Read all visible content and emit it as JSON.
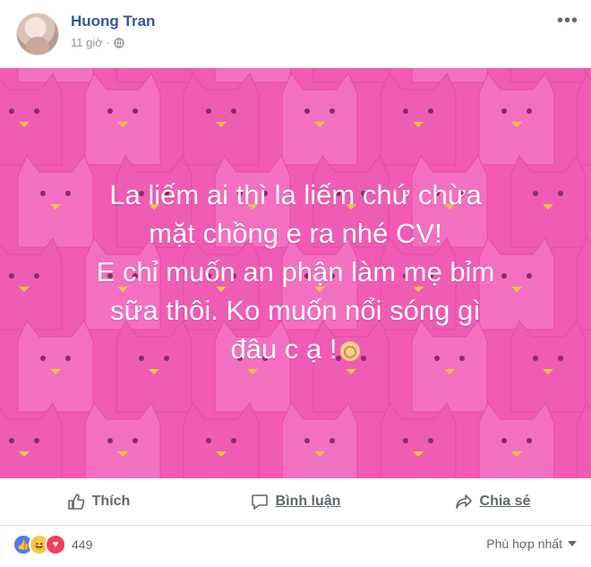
{
  "post": {
    "author": "Huong Tran",
    "time": "11 giờ",
    "lines": [
      "La liếm ai thì la liếm chứ chừa",
      "mặt chồng e ra nhé CV!",
      "E chỉ muốn an phận làm mẹ bỉm",
      "sữa thôi. Ko muốn nổi sóng gì",
      "đâu c ạ !"
    ]
  },
  "actions": {
    "like": "Thích",
    "comment": "Bình luận",
    "share": "Chia sẻ"
  },
  "footer": {
    "reaction_count": "449",
    "sort_label": "Phù hợp nhất"
  },
  "colors": {
    "background": "#f15bb5",
    "link": "#365899"
  }
}
